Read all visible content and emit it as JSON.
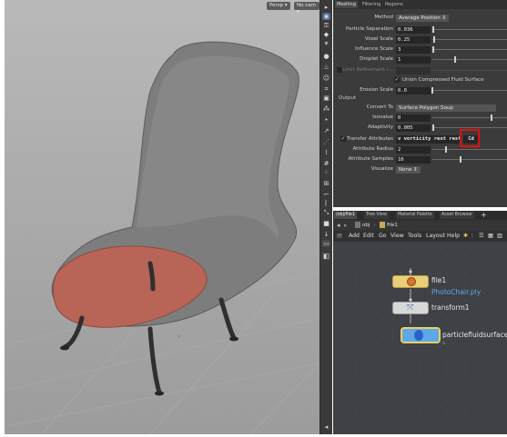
{
  "viewport": {
    "buttons": [
      "Persp ▾",
      "No cam ▾"
    ]
  },
  "params": {
    "tabs": [
      "Meshing",
      "Filtering",
      "Regions"
    ],
    "rows": [
      {
        "label": "Method",
        "type": "menu",
        "value": "Average Position ⇕"
      },
      {
        "label": "Particle Separation",
        "type": "field",
        "value": "0.036"
      },
      {
        "label": "Voxel Scale",
        "type": "field",
        "value": "0.25"
      },
      {
        "label": "Influence Scale",
        "type": "field",
        "value": "3"
      },
      {
        "label": "Droplet Scale",
        "type": "field",
        "value": "1"
      },
      {
        "label": "Limit Refinement I…",
        "type": "field",
        "value": ""
      },
      {
        "label": "",
        "type": "check",
        "value": "Union Compressed Fluid Surface"
      },
      {
        "label": "Erosion Scale",
        "type": "field",
        "value": "0.0"
      }
    ],
    "output_section": "Output",
    "output_rows": [
      {
        "label": "Convert To",
        "type": "menu",
        "value": "Surface Polygon Soup"
      },
      {
        "label": "Isovalue",
        "type": "field",
        "value": "0"
      },
      {
        "label": "Adaptivity",
        "type": "field",
        "value": "0.005"
      },
      {
        "label": "Transfer Attributes",
        "type": "attr",
        "value": "v vorticity rest rest",
        "extra": "Cd"
      },
      {
        "label": "Attribute Radius",
        "type": "field",
        "value": "2"
      },
      {
        "label": "Attribute Samples",
        "type": "field",
        "value": "10"
      },
      {
        "label": "Visualize",
        "type": "menu",
        "value": "None ⇕"
      }
    ]
  },
  "network": {
    "tabs": [
      "/obj/file1",
      "Tree View",
      "Material Palette",
      "Asset Browser"
    ],
    "path": [
      "obj",
      "file1"
    ],
    "menu": [
      "Add",
      "Edit",
      "Go",
      "View",
      "Tools",
      "Layout",
      "Help"
    ],
    "nodes": [
      {
        "name": "file1",
        "sub": "PhotoChair.ply"
      },
      {
        "name": "transform1",
        "sub": ""
      },
      {
        "name": "particlefluidsurface1",
        "sub": ""
      }
    ]
  },
  "colors": {
    "highlight": "#e01010",
    "cushion": "#b86456",
    "chair": "#7a7a7a",
    "node_file": "#e8cf7a",
    "node_selected": "#5fa8e8"
  }
}
